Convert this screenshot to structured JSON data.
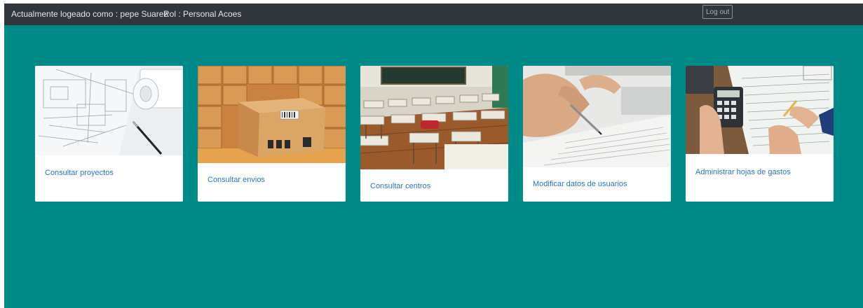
{
  "header": {
    "logged_in_text": "Actualmente logeado como : pepe Suarez",
    "role_text": "Rol : Personal Acoes",
    "logout_label": "Log out"
  },
  "cards": [
    {
      "label": "Consultar proyectos",
      "image": "blueprint-plans-image"
    },
    {
      "label": "Consultar envios",
      "image": "cardboard-boxes-image"
    },
    {
      "label": "Consultar centros",
      "image": "classroom-image"
    },
    {
      "label": "Modificar datos de usuarios",
      "image": "hand-writing-document-image"
    },
    {
      "label": "Administrar hojas de gastos",
      "image": "calculator-expenses-image"
    }
  ],
  "colors": {
    "background": "#008a87",
    "topbar": "#31363c",
    "link": "#2a74c9"
  }
}
